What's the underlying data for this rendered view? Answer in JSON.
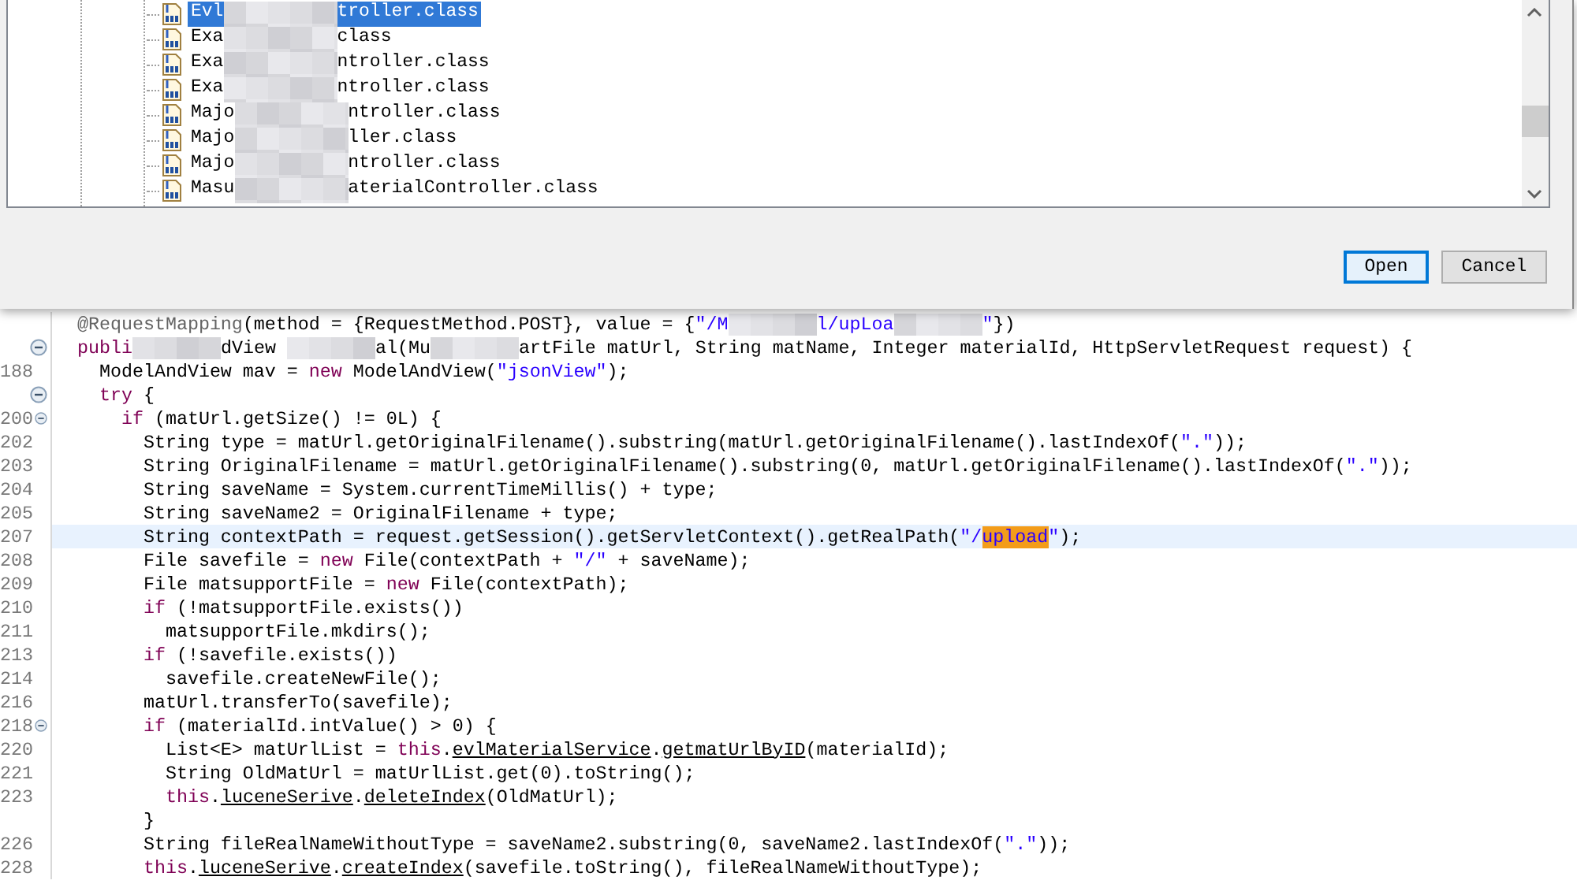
{
  "dialog": {
    "files": [
      {
        "prefix": "Evl",
        "suffix": "troller.class",
        "selected": true
      },
      {
        "prefix": "Exa",
        "suffix": "class",
        "selected": false
      },
      {
        "prefix": "Exa",
        "suffix": "ntroller.class",
        "selected": false
      },
      {
        "prefix": "Exa",
        "suffix": "ntroller.class",
        "selected": false
      },
      {
        "prefix": "Majo",
        "suffix": "ntroller.class",
        "selected": false
      },
      {
        "prefix": "Majo",
        "suffix": "ller.class",
        "selected": false
      },
      {
        "prefix": "Majo",
        "suffix": "ntroller.class",
        "selected": false
      },
      {
        "prefix": "Masu",
        "suffix": "aterialController.class",
        "selected": false
      }
    ],
    "buttons": [
      {
        "label": "Open",
        "default": true
      },
      {
        "label": "Cancel",
        "default": false
      }
    ]
  },
  "editor": {
    "lines": [
      {
        "fold": false,
        "current": false,
        "tokens": [
          {
            "kind": "annotation",
            "text": "@RequestMapping"
          },
          {
            "kind": "plain",
            "text": "(method = {RequestMethod.POST}, value = {"
          },
          {
            "kind": "string",
            "text": "\"/M"
          },
          {
            "kind": "redacted"
          },
          {
            "kind": "string",
            "text": "l/upLoa"
          },
          {
            "kind": "redacted"
          },
          {
            "kind": "string",
            "text": "\""
          },
          {
            "kind": "plain",
            "text": "})"
          }
        ]
      },
      {
        "fold": true,
        "current": false,
        "tokens": [
          {
            "kind": "keyword",
            "text": "publi"
          },
          {
            "kind": "redacted"
          },
          {
            "kind": "plain",
            "text": "dView "
          },
          {
            "kind": "redacted"
          },
          {
            "kind": "plain",
            "text": "al(Mu"
          },
          {
            "kind": "redacted"
          },
          {
            "kind": "plain",
            "text": "artFile matUrl, String matName, Integer materialId, HttpServletRequest request) {"
          }
        ]
      },
      {
        "number": "188",
        "fold": false,
        "current": false,
        "tokens": [
          {
            "kind": "plain",
            "text": "  ModelAndView mav = "
          },
          {
            "kind": "keyword",
            "text": "new"
          },
          {
            "kind": "plain",
            "text": " ModelAndView("
          },
          {
            "kind": "string",
            "text": "\"jsonView\""
          },
          {
            "kind": "plain",
            "text": ");"
          }
        ]
      },
      {
        "fold": true,
        "current": false,
        "tokens": [
          {
            "kind": "keyword",
            "text": "  try"
          },
          {
            "kind": "plain",
            "text": " {"
          }
        ]
      },
      {
        "number": "200",
        "fold": true,
        "current": false,
        "tokens": [
          {
            "kind": "keyword",
            "text": "    if"
          },
          {
            "kind": "plain",
            "text": " (matUrl.getSize() != 0L) {"
          }
        ]
      },
      {
        "number": "202",
        "fold": false,
        "current": false,
        "tokens": [
          {
            "kind": "plain",
            "text": "      String type = matUrl.getOriginalFilename().substring(matUrl.getOriginalFilename().lastIndexOf("
          },
          {
            "kind": "string",
            "text": "\".\""
          },
          {
            "kind": "plain",
            "text": "));"
          }
        ]
      },
      {
        "number": "203",
        "fold": false,
        "current": false,
        "tokens": [
          {
            "kind": "plain",
            "text": "      String OriginalFilename = matUrl.getOriginalFilename().substring(0, matUrl.getOriginalFilename().lastIndexOf("
          },
          {
            "kind": "string",
            "text": "\".\""
          },
          {
            "kind": "plain",
            "text": "));"
          }
        ]
      },
      {
        "number": "204",
        "fold": false,
        "current": false,
        "tokens": [
          {
            "kind": "plain",
            "text": "      String saveName = System.currentTimeMillis() + type;"
          }
        ]
      },
      {
        "number": "205",
        "fold": false,
        "current": false,
        "tokens": [
          {
            "kind": "plain",
            "text": "      String saveName2 = OriginalFilename + type;"
          }
        ]
      },
      {
        "number": "207",
        "fold": false,
        "current": true,
        "tokens": [
          {
            "kind": "plain",
            "text": "      String contextPath = request.getSession().getServletContext().getRealPath("
          },
          {
            "kind": "string",
            "text": "\"/"
          },
          {
            "kind": "match",
            "text": "upload"
          },
          {
            "kind": "string",
            "text": "\""
          },
          {
            "kind": "plain",
            "text": ");"
          }
        ]
      },
      {
        "number": "208",
        "fold": false,
        "current": false,
        "tokens": [
          {
            "kind": "plain",
            "text": "      File savefile = "
          },
          {
            "kind": "keyword",
            "text": "new"
          },
          {
            "kind": "plain",
            "text": " File(contextPath + "
          },
          {
            "kind": "string",
            "text": "\"/\""
          },
          {
            "kind": "plain",
            "text": " + saveName);"
          }
        ]
      },
      {
        "number": "209",
        "fold": false,
        "current": false,
        "tokens": [
          {
            "kind": "plain",
            "text": "      File matsupportFile = "
          },
          {
            "kind": "keyword",
            "text": "new"
          },
          {
            "kind": "plain",
            "text": " File(contextPath);"
          }
        ]
      },
      {
        "number": "210",
        "fold": false,
        "current": false,
        "tokens": [
          {
            "kind": "keyword",
            "text": "      if"
          },
          {
            "kind": "plain",
            "text": " (!matsupportFile.exists())"
          }
        ]
      },
      {
        "number": "211",
        "fold": false,
        "current": false,
        "tokens": [
          {
            "kind": "plain",
            "text": "        matsupportFile.mkdirs();"
          }
        ]
      },
      {
        "number": "213",
        "fold": false,
        "current": false,
        "tokens": [
          {
            "kind": "keyword",
            "text": "      if"
          },
          {
            "kind": "plain",
            "text": " (!savefile.exists())"
          }
        ]
      },
      {
        "number": "214",
        "fold": false,
        "current": false,
        "tokens": [
          {
            "kind": "plain",
            "text": "        savefile.createNewFile();"
          }
        ]
      },
      {
        "number": "216",
        "fold": false,
        "current": false,
        "tokens": [
          {
            "kind": "plain",
            "text": "      matUrl.transferTo(savefile);"
          }
        ]
      },
      {
        "number": "218",
        "fold": true,
        "current": false,
        "tokens": [
          {
            "kind": "keyword",
            "text": "      if"
          },
          {
            "kind": "plain",
            "text": " (materialId.intValue() > 0) {"
          }
        ]
      },
      {
        "number": "220",
        "fold": false,
        "current": false,
        "tokens": [
          {
            "kind": "plain",
            "text": "        List<E> matUrlList = "
          },
          {
            "kind": "keyword",
            "text": "this"
          },
          {
            "kind": "plain",
            "text": "."
          },
          {
            "kind": "link",
            "text": "evlMaterialService"
          },
          {
            "kind": "plain",
            "text": "."
          },
          {
            "kind": "link",
            "text": "getmatUrlByID"
          },
          {
            "kind": "plain",
            "text": "(materialId);"
          }
        ]
      },
      {
        "number": "221",
        "fold": false,
        "current": false,
        "tokens": [
          {
            "kind": "plain",
            "text": "        String OldMatUrl = matUrlList.get(0).toString();"
          }
        ]
      },
      {
        "number": "223",
        "fold": false,
        "current": false,
        "tokens": [
          {
            "kind": "keyword",
            "text": "        this"
          },
          {
            "kind": "plain",
            "text": "."
          },
          {
            "kind": "link",
            "text": "luceneSerive"
          },
          {
            "kind": "plain",
            "text": "."
          },
          {
            "kind": "link",
            "text": "deleteIndex"
          },
          {
            "kind": "plain",
            "text": "(OldMatUrl);"
          }
        ]
      },
      {
        "fold": false,
        "current": false,
        "tokens": [
          {
            "kind": "plain",
            "text": "      }"
          }
        ]
      },
      {
        "number": "226",
        "fold": false,
        "current": false,
        "tokens": [
          {
            "kind": "plain",
            "text": "      String fileRealNameWithoutType = saveName2.substring(0, saveName2.lastIndexOf("
          },
          {
            "kind": "string",
            "text": "\".\""
          },
          {
            "kind": "plain",
            "text": "));"
          }
        ]
      },
      {
        "number": "228",
        "fold": false,
        "current": false,
        "tokens": [
          {
            "kind": "keyword",
            "text": "      this"
          },
          {
            "kind": "plain",
            "text": "."
          },
          {
            "kind": "link",
            "text": "luceneSerive"
          },
          {
            "kind": "plain",
            "text": "."
          },
          {
            "kind": "link",
            "text": "createIndex"
          },
          {
            "kind": "plain",
            "text": "(savefile.toString(), fileRealNameWithoutType);"
          }
        ]
      }
    ]
  }
}
